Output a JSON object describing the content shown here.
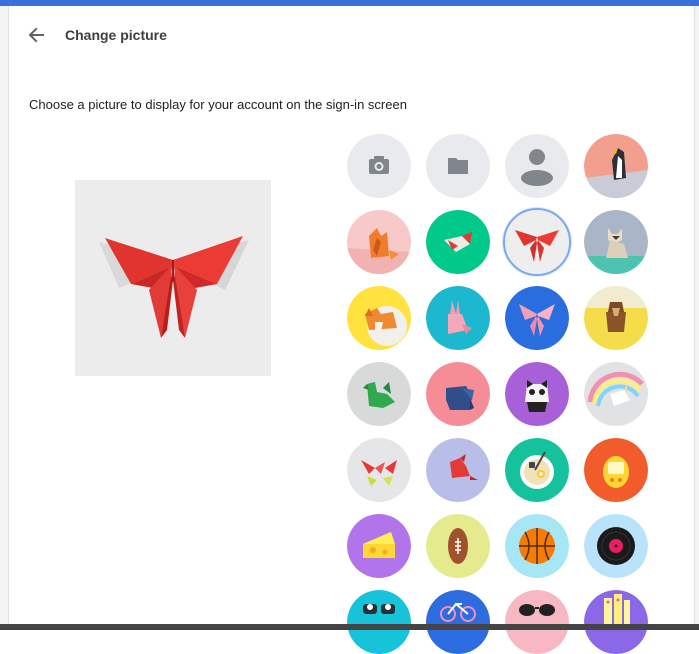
{
  "header": {
    "title": "Change picture",
    "back_icon": "arrow-left-icon"
  },
  "description": "Choose a picture to display for your account on the sign-in screen",
  "preview": {
    "image": "red-origami-butterfly"
  },
  "selected_index": 6,
  "avatars": [
    {
      "name": "camera-option",
      "icon": "camera-icon",
      "bg": "#e8eaed"
    },
    {
      "name": "file-option",
      "icon": "folder-icon",
      "bg": "#e8eaed"
    },
    {
      "name": "default-profile-option",
      "icon": "person-icon",
      "bg": "#e8eaed"
    },
    {
      "name": "origami-penguin",
      "icon": "penguin-icon",
      "bg": "#f2a08d"
    },
    {
      "name": "origami-fox",
      "icon": "fox-icon",
      "bg": "#f7c9c9"
    },
    {
      "name": "origami-bird-green",
      "icon": "bird-icon",
      "bg": "#00c98a"
    },
    {
      "name": "origami-butterfly",
      "icon": "butterfly-icon",
      "bg": "#eeeeee"
    },
    {
      "name": "origami-cat",
      "icon": "cat-icon",
      "bg": "#aab6c8"
    },
    {
      "name": "origami-corgi",
      "icon": "dog-icon",
      "bg": "#ffe23d"
    },
    {
      "name": "origami-rabbit",
      "icon": "rabbit-icon",
      "bg": "#1bb8cf"
    },
    {
      "name": "origami-butterfly-blue",
      "icon": "butterfly-icon",
      "bg": "#2a6ddf"
    },
    {
      "name": "origami-monkey",
      "icon": "monkey-icon",
      "bg": "#f5dc4a"
    },
    {
      "name": "origami-dragon",
      "icon": "dragon-icon",
      "bg": "#d8dad9"
    },
    {
      "name": "origami-elephant",
      "icon": "elephant-icon",
      "bg": "#f58d97"
    },
    {
      "name": "origami-panda",
      "icon": "panda-icon",
      "bg": "#a860d8"
    },
    {
      "name": "origami-unicorn",
      "icon": "unicorn-icon",
      "bg": "#e0e2e3"
    },
    {
      "name": "origami-cranes",
      "icon": "crane-icon",
      "bg": "#e5e6e7"
    },
    {
      "name": "origami-red-bird",
      "icon": "bird-icon",
      "bg": "#b8bee8"
    },
    {
      "name": "ramen-bowl",
      "icon": "bowl-icon",
      "bg": "#16c29c"
    },
    {
      "name": "virtual-pet",
      "icon": "pet-toy-icon",
      "bg": "#f25c2c"
    },
    {
      "name": "cheese",
      "icon": "cheese-icon",
      "bg": "#b274ea"
    },
    {
      "name": "football",
      "icon": "football-icon",
      "bg": "#e4ea8d"
    },
    {
      "name": "basketball",
      "icon": "basketball-icon",
      "bg": "#a6e6f5"
    },
    {
      "name": "vinyl-record",
      "icon": "record-icon",
      "bg": "#b9e2fb"
    },
    {
      "name": "sushi",
      "icon": "sushi-icon",
      "bg": "#17c3d8"
    },
    {
      "name": "bicycle",
      "icon": "bicycle-icon",
      "bg": "#2d6be0"
    },
    {
      "name": "sunglasses",
      "icon": "sunglasses-icon",
      "bg": "#f7b8c4"
    },
    {
      "name": "city-lights",
      "icon": "city-icon",
      "bg": "#8a68e8"
    }
  ]
}
